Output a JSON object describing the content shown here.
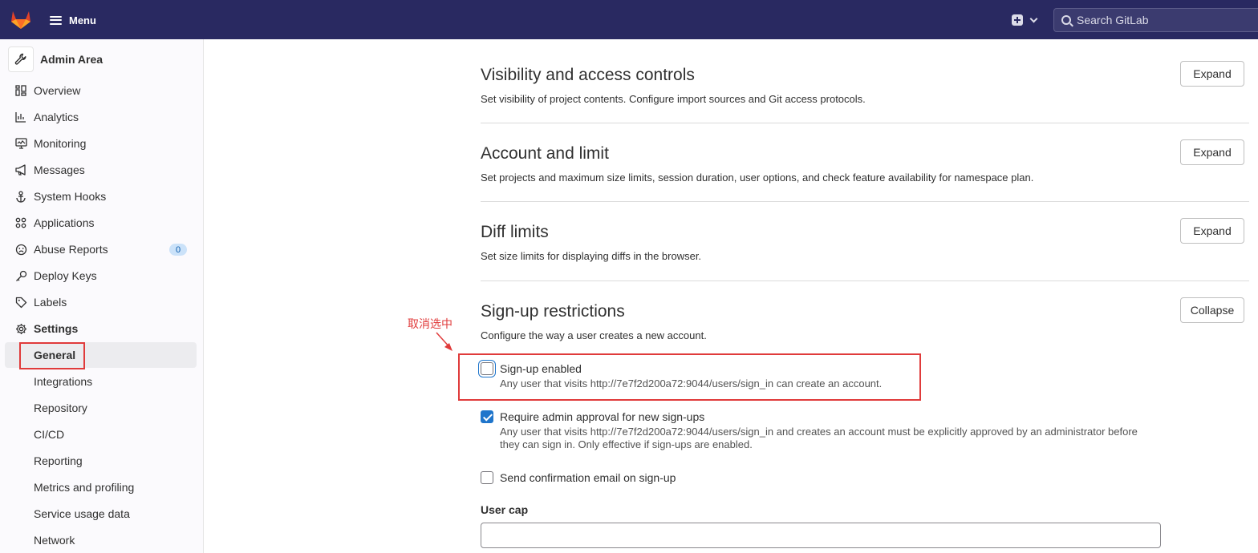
{
  "topbar": {
    "menu_label": "Menu",
    "search_placeholder": "Search GitLab"
  },
  "sidebar": {
    "title": "Admin Area",
    "items": [
      {
        "label": "Overview",
        "icon": "overview-icon"
      },
      {
        "label": "Analytics",
        "icon": "analytics-icon"
      },
      {
        "label": "Monitoring",
        "icon": "monitor-icon"
      },
      {
        "label": "Messages",
        "icon": "megaphone-icon"
      },
      {
        "label": "System Hooks",
        "icon": "anchor-icon"
      },
      {
        "label": "Applications",
        "icon": "applications-icon"
      },
      {
        "label": "Abuse Reports",
        "icon": "sad-face-icon",
        "badge": "0"
      },
      {
        "label": "Deploy Keys",
        "icon": "key-icon"
      },
      {
        "label": "Labels",
        "icon": "label-icon"
      },
      {
        "label": "Settings",
        "icon": "gear-icon"
      }
    ],
    "settings_subitems": [
      "General",
      "Integrations",
      "Repository",
      "CI/CD",
      "Reporting",
      "Metrics and profiling",
      "Service usage data",
      "Network"
    ]
  },
  "sections": [
    {
      "title": "Visibility and access controls",
      "description": "Set visibility of project contents. Configure import sources and Git access protocols.",
      "button": "Expand"
    },
    {
      "title": "Account and limit",
      "description": "Set projects and maximum size limits, session duration, user options, and check feature availability for namespace plan.",
      "button": "Expand"
    },
    {
      "title": "Diff limits",
      "description": "Set size limits for displaying diffs in the browser.",
      "button": "Expand"
    },
    {
      "title": "Sign-up restrictions",
      "description": "Configure the way a user creates a new account.",
      "button": "Collapse"
    }
  ],
  "signup": {
    "options": [
      {
        "label": "Sign-up enabled",
        "help": "Any user that visits http://7e7f2d200a72:9044/users/sign_in can create an account.",
        "checked": false
      },
      {
        "label": "Require admin approval for new sign-ups",
        "help": "Any user that visits http://7e7f2d200a72:9044/users/sign_in and creates an account must be explicitly approved by an administrator before they can sign in. Only effective if sign-ups are enabled.",
        "checked": true
      },
      {
        "label": "Send confirmation email on sign-up",
        "help": "",
        "checked": false
      }
    ],
    "user_cap_label": "User cap",
    "user_cap_value": ""
  },
  "annotation": {
    "text": "取消选中",
    "color": "#e03b3b"
  }
}
